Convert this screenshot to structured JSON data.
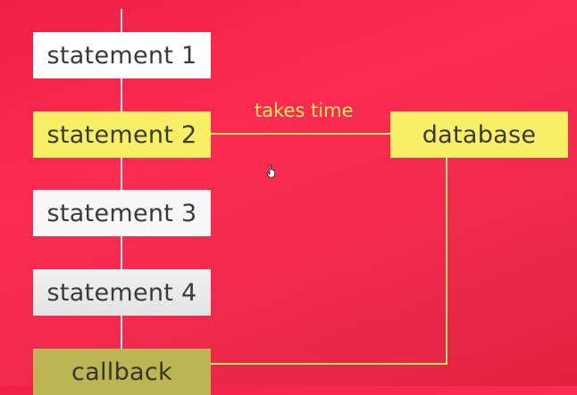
{
  "statements": [
    "statement 1",
    "statement 2",
    "statement 3",
    "statement 4"
  ],
  "callback": "callback",
  "database": "database",
  "delay_label": "takes time",
  "colors": {
    "background": "#fd2b51",
    "highlight": "#f9ef67",
    "callback": "#bdb554",
    "connector": "#f5e46a",
    "timeline": "#ffffff"
  }
}
